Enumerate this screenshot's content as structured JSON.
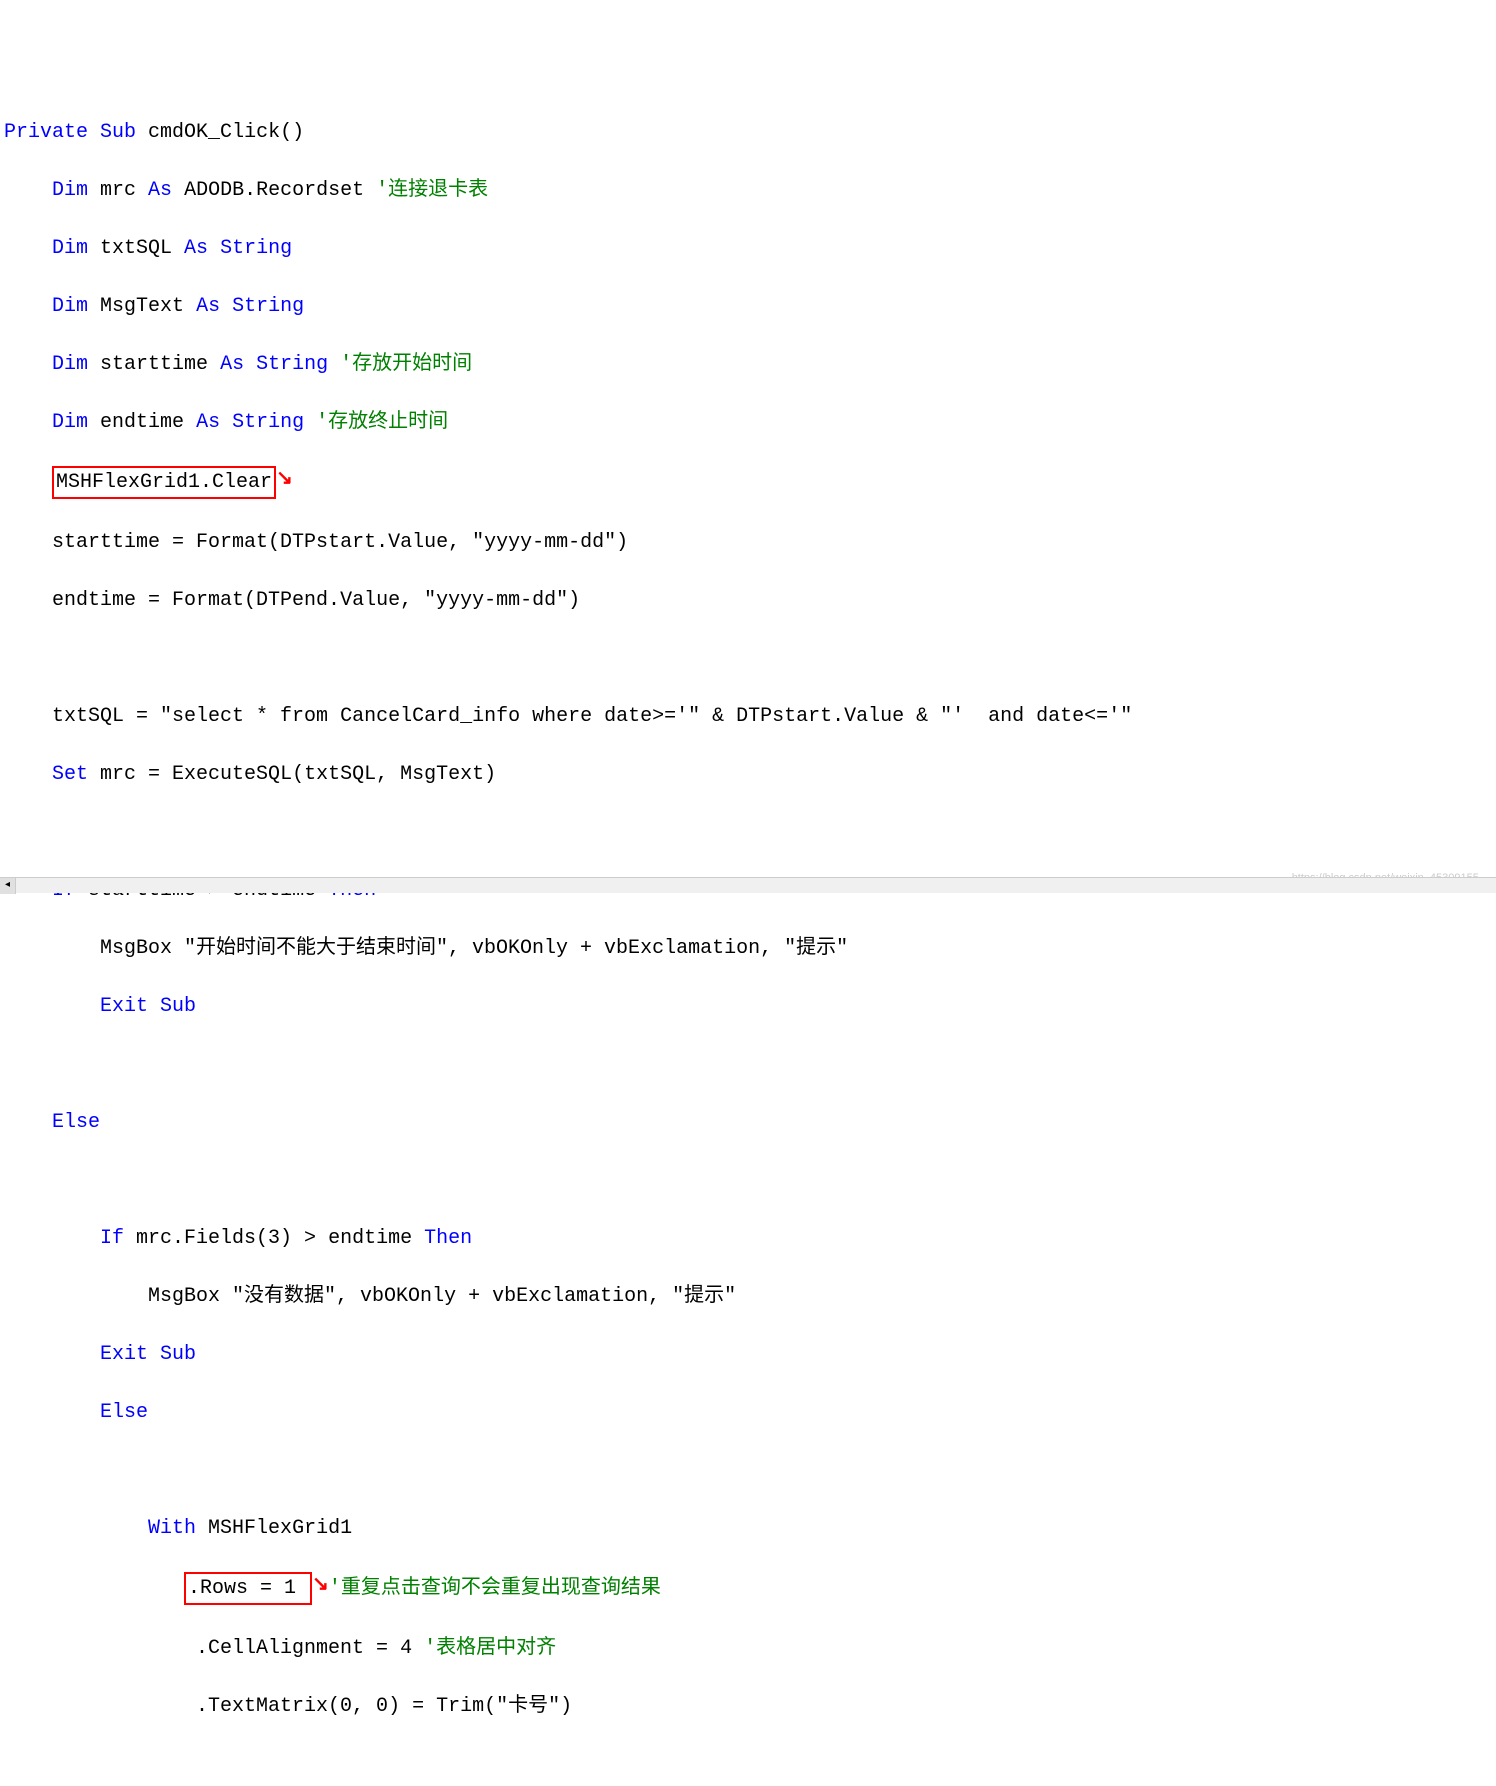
{
  "code": {
    "l1a": "Private",
    "l1b": "Sub",
    "l1c": " cmdOK_Click()",
    "l2a": "Dim",
    "l2b": " mrc ",
    "l2c": "As",
    "l2d": " ADODB.Recordset ",
    "l2e": "'连接退卡表",
    "l3a": "Dim",
    "l3b": " txtSQL ",
    "l3c": "As",
    "l3d": " String",
    "l4a": "Dim",
    "l4b": " MsgText ",
    "l4c": "As",
    "l4d": " String",
    "l5a": "Dim",
    "l5b": " starttime ",
    "l5c": "As",
    "l5d": " String ",
    "l5e": "'存放开始时间",
    "l6a": "Dim",
    "l6b": " endtime ",
    "l6c": "As",
    "l6d": " String ",
    "l6e": "'存放终止时间",
    "l7box": "MSHFlexGrid1.Clear",
    "l8": "starttime = Format(DTPstart.Value, \"yyyy-mm-dd\")",
    "l9": "endtime = Format(DTPend.Value, \"yyyy-mm-dd\")",
    "l10": "txtSQL = \"select * from CancelCard_info where date>='\" & DTPstart.Value & \"'  and date<='\"",
    "l11a": "Set",
    "l11b": " mrc = ExecuteSQL(txtSQL, MsgText)",
    "l12a": "If",
    "l12b": " starttime > endtime ",
    "l12c": "Then",
    "l13": "MsgBox \"开始时间不能大于结束时间\", vbOKOnly + vbExclamation, \"提示\"",
    "l14a": "Exit",
    "l14b": " ",
    "l14c": "Sub",
    "l15a": "Else",
    "l16a": "If",
    "l16b": " mrc.Fields(3) > endtime ",
    "l16c": "Then",
    "l17": "MsgBox \"没有数据\", vbOKOnly + vbExclamation, \"提示\"",
    "l18a": "Exit",
    "l18b": " ",
    "l18c": "Sub",
    "l19a": "Else",
    "l20a": "With",
    "l20b": " MSHFlexGrid1",
    "l21box": ".Rows = 1 ",
    "l21c": "'重复点击查询不会重复出现查询结果",
    "l22a": ".CellAlignment = 4 ",
    "l22b": "'表格居中对齐",
    "l23": ".TextMatrix(0, 0) = Trim(\"卡号\")"
  },
  "watermark": "https://blog.csdn.net/weixin_45309155...",
  "arrow": "↘"
}
